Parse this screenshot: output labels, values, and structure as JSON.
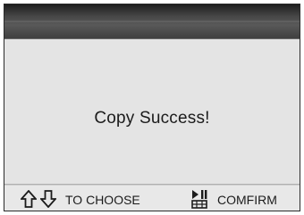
{
  "dialog": {
    "message": "Copy Success!"
  },
  "footer": {
    "choose_label": "TO CHOOSE",
    "confirm_label": "COMFIRM",
    "icons": [
      "arrow-up-icon",
      "arrow-down-icon",
      "play-pause-icon"
    ]
  },
  "colors": {
    "title_bar": "#3f3f3f",
    "background": "#e4e4e4",
    "text": "#1b1b1b"
  }
}
